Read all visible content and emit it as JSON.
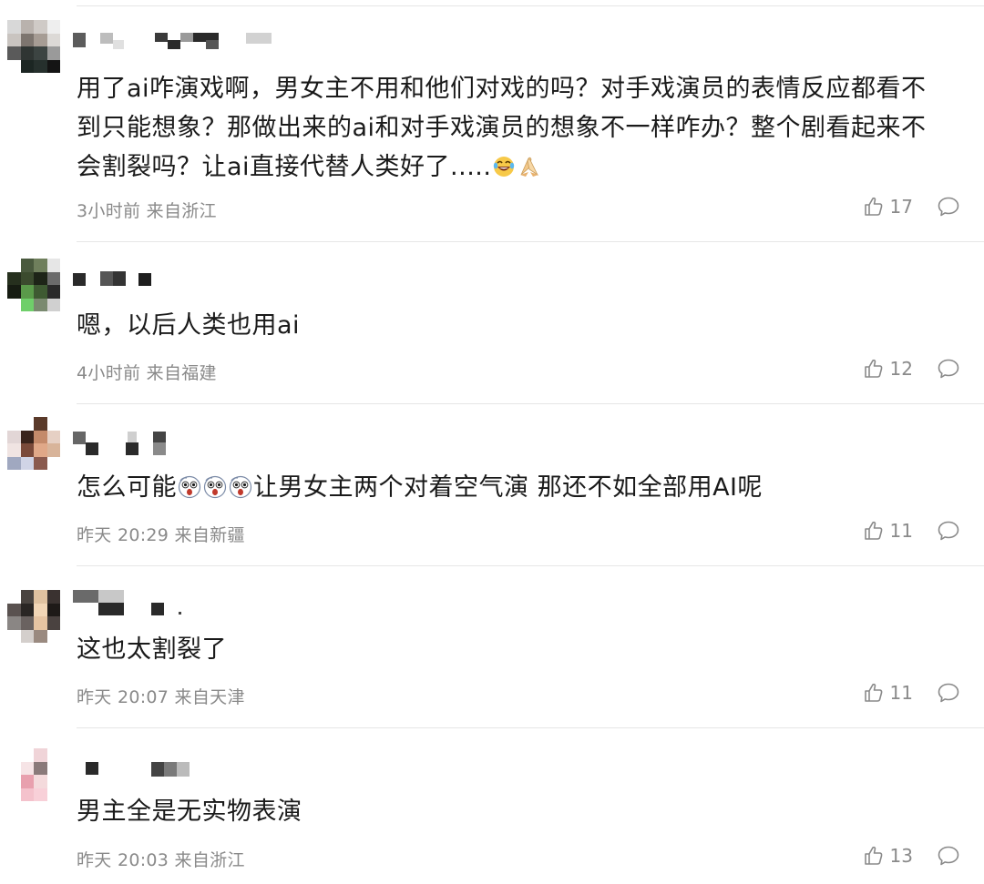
{
  "comments": [
    {
      "text": "用了ai咋演戏啊，男女主不用和他们对戏的吗？对手戏演员的表情反应都看不到只能想象？那做出来的ai和对手戏演员的想象不一样咋办？整个剧看起来不会割裂吗？让ai直接代替人类好了.....",
      "emojis": [
        "laugh-cry-emoji",
        "pray-hands-emoji"
      ],
      "time": "3小时前",
      "location": "来自浙江",
      "likes": "17"
    },
    {
      "text": "嗯，以后人类也用ai",
      "time": "4小时前",
      "location": "来自福建",
      "likes": "12"
    },
    {
      "text_before": "怎么可能",
      "text_after": "让男女主两个对着空气演 那还不如全部用AI呢",
      "emojis": [
        "shocked-face-emoji",
        "shocked-face-emoji",
        "shocked-face-emoji"
      ],
      "time": "昨天 20:29",
      "location": "来自新疆",
      "likes": "11"
    },
    {
      "text": "这也太割裂了",
      "time": "昨天 20:07",
      "location": "来自天津",
      "likes": "11"
    },
    {
      "text": "男主全是无实物表演",
      "time": "昨天 20:03",
      "location": "来自浙江",
      "likes": "13"
    }
  ],
  "icons": {
    "like": "thumbs-up-icon",
    "reply": "comment-bubble-icon"
  },
  "colors": {
    "text": "#1a1a1a",
    "meta": "#8a8a8a",
    "divider": "#e6e6e6"
  }
}
